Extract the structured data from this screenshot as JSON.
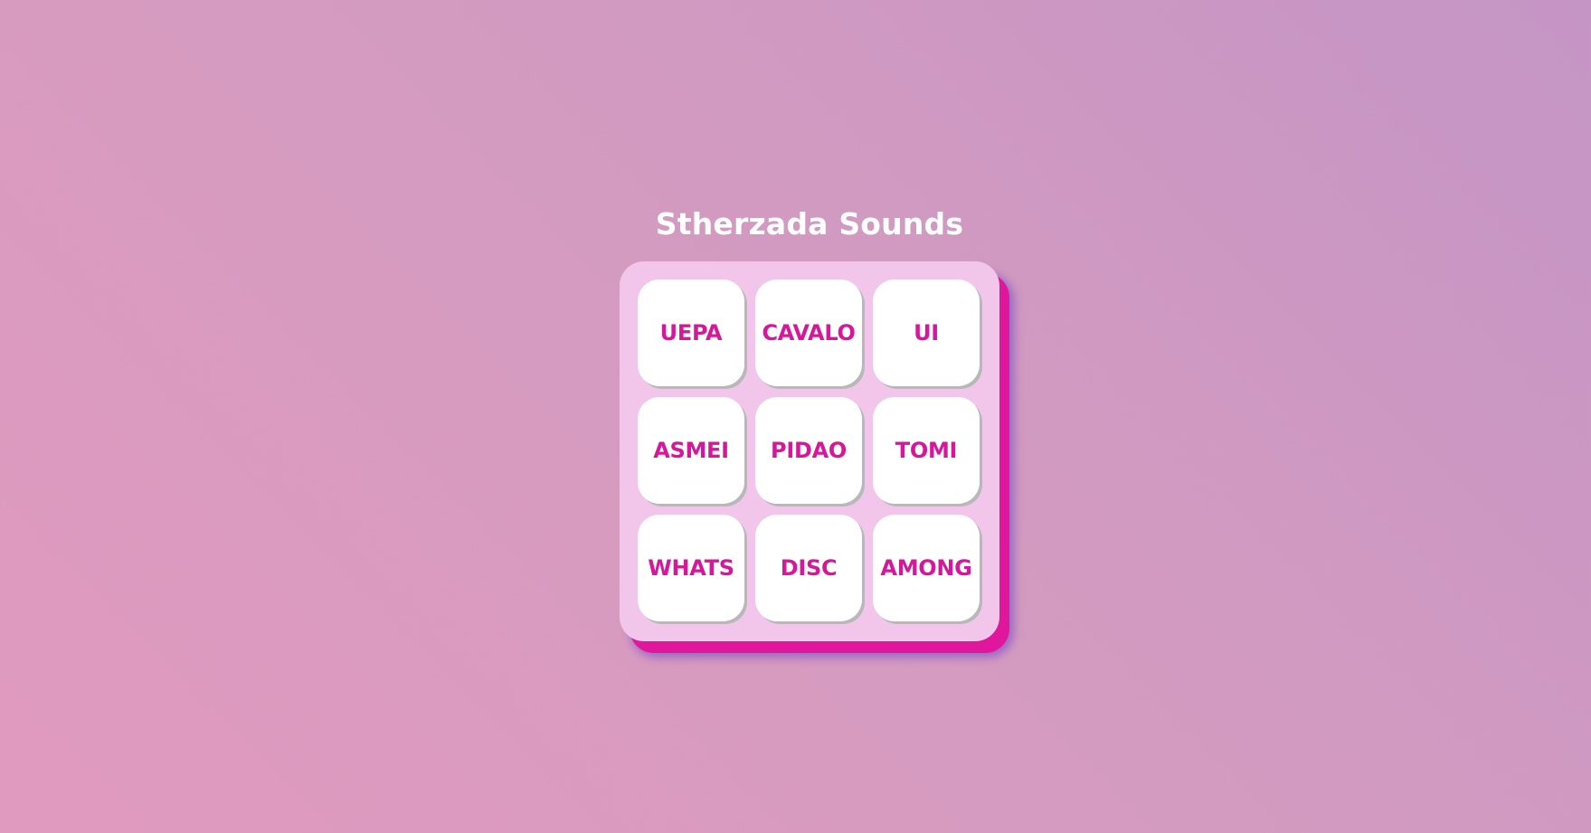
{
  "app": {
    "title": "Stherzada Sounds"
  },
  "pad": {
    "keys": [
      {
        "label": "UEPA"
      },
      {
        "label": "CAVALO"
      },
      {
        "label": "UI"
      },
      {
        "label": "ASMEI"
      },
      {
        "label": "PIDAO"
      },
      {
        "label": "TOMI"
      },
      {
        "label": "WHATS"
      },
      {
        "label": "DISC"
      },
      {
        "label": "AMONG"
      }
    ]
  },
  "colors": {
    "key_text": "#d6179c",
    "pad_background": "#f2c6eb",
    "pad_shadow": "#e0169d",
    "title_text": "#ffffff"
  }
}
